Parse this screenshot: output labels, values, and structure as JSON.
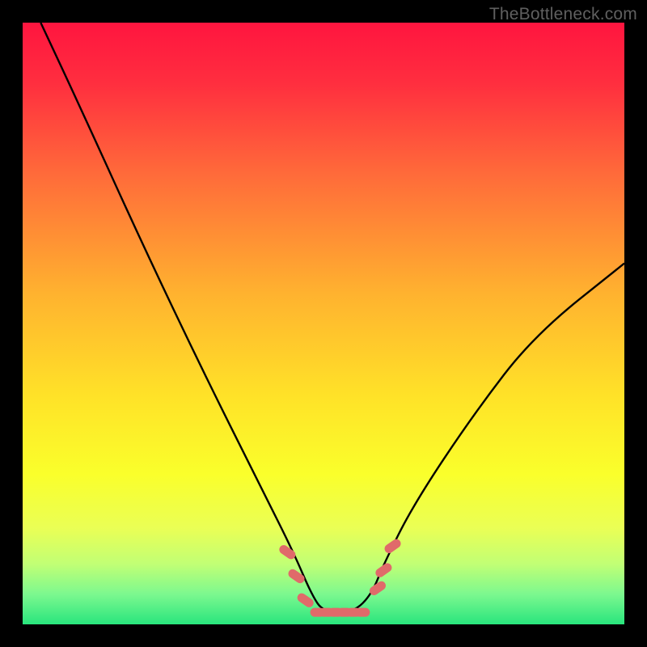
{
  "watermark": "TheBottleneck.com",
  "chart_data": {
    "type": "line",
    "title": "",
    "xlabel": "",
    "ylabel": "",
    "xlim": [
      0,
      100
    ],
    "ylim": [
      0,
      100
    ],
    "series": [
      {
        "name": "bottleneck-curve",
        "x": [
          3,
          10,
          20,
          30,
          40,
          45,
          48,
          50,
          55,
          58,
          60,
          65,
          75,
          85,
          100
        ],
        "y": [
          100,
          85,
          63,
          42,
          22,
          12,
          5,
          2,
          2,
          5,
          10,
          20,
          35,
          48,
          60
        ]
      }
    ],
    "gradient_stops": [
      {
        "pos": 0.0,
        "color": "#ff153f"
      },
      {
        "pos": 0.1,
        "color": "#ff2e3f"
      },
      {
        "pos": 0.25,
        "color": "#ff6a3a"
      },
      {
        "pos": 0.45,
        "color": "#ffb22f"
      },
      {
        "pos": 0.62,
        "color": "#ffe228"
      },
      {
        "pos": 0.75,
        "color": "#faff2b"
      },
      {
        "pos": 0.84,
        "color": "#eaff55"
      },
      {
        "pos": 0.9,
        "color": "#c1ff75"
      },
      {
        "pos": 0.95,
        "color": "#7cf88f"
      },
      {
        "pos": 1.0,
        "color": "#29e57d"
      }
    ],
    "markers": {
      "left": {
        "x": [
          44,
          45.5,
          47
        ],
        "y": [
          12,
          8,
          4
        ]
      },
      "right": {
        "x": [
          59,
          60,
          61.5
        ],
        "y": [
          6,
          9,
          13
        ]
      },
      "flat": {
        "x": [
          49,
          50.5,
          52,
          53.5,
          55,
          56.5
        ],
        "y": [
          2,
          2,
          2,
          2,
          2,
          2
        ]
      }
    },
    "marker_color": "#e06a6a"
  }
}
